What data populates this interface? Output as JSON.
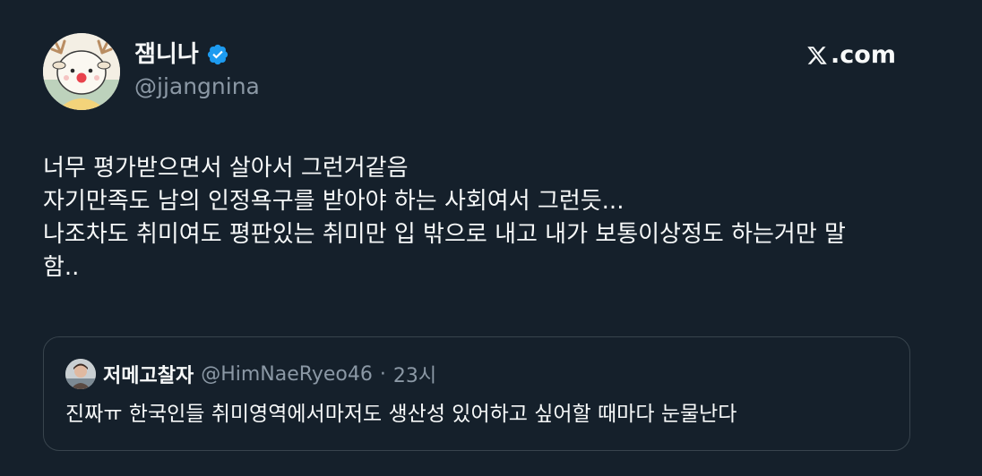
{
  "author": {
    "display_name": "잼니나",
    "handle": "@jjangnina",
    "verified": true,
    "avatar_icon": "reindeer-avatar-icon"
  },
  "brand": {
    "text": ".com",
    "icon": "x-logo-icon"
  },
  "tweet": {
    "lines": [
      "너무 평가받으면서 살아서 그런거같음",
      "자기만족도 남의 인정욕구를 받아야 하는 사회여서 그런듯...",
      "나조차도 취미여도 평판있는 취미만 입 밖으로 내고 내가 보통이상정도 하는거만 말",
      "함.."
    ]
  },
  "quoted": {
    "display_name": "저메고찰자",
    "handle": "@HimNaeRyeo46",
    "separator": "·",
    "time": "23시",
    "text": "진짜ㅠ 한국인들 취미영역에서마저도 생산성 있어하고 싶어할 때마다 눈물난다"
  },
  "colors": {
    "background": "#15202b",
    "primary_text": "#f7f9f9",
    "secondary_text": "#8b98a5",
    "border": "#38444d",
    "verified": "#1d9bf0"
  }
}
